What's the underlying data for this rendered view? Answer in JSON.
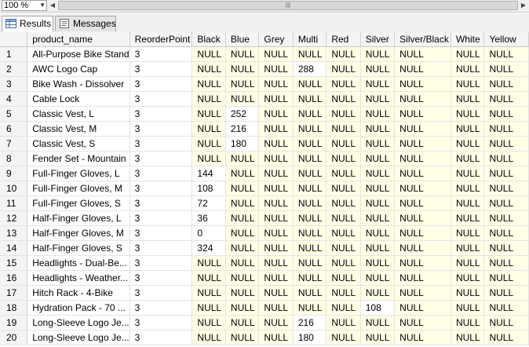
{
  "toolbar": {
    "zoom": "100 %"
  },
  "tabs": [
    {
      "label": "Results"
    },
    {
      "label": "Messages"
    }
  ],
  "grid": {
    "columns": [
      "product_name",
      "ReorderPoint",
      "Black",
      "Blue",
      "Grey",
      "Multi",
      "Red",
      "Silver",
      "Silver/Black",
      "White",
      "Yellow"
    ],
    "rows": [
      [
        "1",
        "All-Purpose Bike Stand",
        "3",
        "NULL",
        "NULL",
        "NULL",
        "NULL",
        "NULL",
        "NULL",
        "NULL",
        "NULL",
        "NULL"
      ],
      [
        "2",
        "AWC Logo Cap",
        "3",
        "NULL",
        "NULL",
        "NULL",
        "288",
        "NULL",
        "NULL",
        "NULL",
        "NULL",
        "NULL"
      ],
      [
        "3",
        "Bike Wash - Dissolver",
        "3",
        "NULL",
        "NULL",
        "NULL",
        "NULL",
        "NULL",
        "NULL",
        "NULL",
        "NULL",
        "NULL"
      ],
      [
        "4",
        "Cable Lock",
        "3",
        "NULL",
        "NULL",
        "NULL",
        "NULL",
        "NULL",
        "NULL",
        "NULL",
        "NULL",
        "NULL"
      ],
      [
        "5",
        "Classic Vest, L",
        "3",
        "NULL",
        "252",
        "NULL",
        "NULL",
        "NULL",
        "NULL",
        "NULL",
        "NULL",
        "NULL"
      ],
      [
        "6",
        "Classic Vest, M",
        "3",
        "NULL",
        "216",
        "NULL",
        "NULL",
        "NULL",
        "NULL",
        "NULL",
        "NULL",
        "NULL"
      ],
      [
        "7",
        "Classic Vest, S",
        "3",
        "NULL",
        "180",
        "NULL",
        "NULL",
        "NULL",
        "NULL",
        "NULL",
        "NULL",
        "NULL"
      ],
      [
        "8",
        "Fender Set - Mountain",
        "3",
        "NULL",
        "NULL",
        "NULL",
        "NULL",
        "NULL",
        "NULL",
        "NULL",
        "NULL",
        "NULL"
      ],
      [
        "9",
        "Full-Finger Gloves, L",
        "3",
        "144",
        "NULL",
        "NULL",
        "NULL",
        "NULL",
        "NULL",
        "NULL",
        "NULL",
        "NULL"
      ],
      [
        "10",
        "Full-Finger Gloves, M",
        "3",
        "108",
        "NULL",
        "NULL",
        "NULL",
        "NULL",
        "NULL",
        "NULL",
        "NULL",
        "NULL"
      ],
      [
        "11",
        "Full-Finger Gloves, S",
        "3",
        "72",
        "NULL",
        "NULL",
        "NULL",
        "NULL",
        "NULL",
        "NULL",
        "NULL",
        "NULL"
      ],
      [
        "12",
        "Half-Finger Gloves, L",
        "3",
        "36",
        "NULL",
        "NULL",
        "NULL",
        "NULL",
        "NULL",
        "NULL",
        "NULL",
        "NULL"
      ],
      [
        "13",
        "Half-Finger Gloves, M",
        "3",
        "0",
        "NULL",
        "NULL",
        "NULL",
        "NULL",
        "NULL",
        "NULL",
        "NULL",
        "NULL"
      ],
      [
        "14",
        "Half-Finger Gloves, S",
        "3",
        "324",
        "NULL",
        "NULL",
        "NULL",
        "NULL",
        "NULL",
        "NULL",
        "NULL",
        "NULL"
      ],
      [
        "15",
        "Headlights - Dual-Be...",
        "3",
        "NULL",
        "NULL",
        "NULL",
        "NULL",
        "NULL",
        "NULL",
        "NULL",
        "NULL",
        "NULL"
      ],
      [
        "16",
        "Headlights - Weather...",
        "3",
        "NULL",
        "NULL",
        "NULL",
        "NULL",
        "NULL",
        "NULL",
        "NULL",
        "NULL",
        "NULL"
      ],
      [
        "17",
        "Hitch Rack - 4-Bike",
        "3",
        "NULL",
        "NULL",
        "NULL",
        "NULL",
        "NULL",
        "NULL",
        "NULL",
        "NULL",
        "NULL"
      ],
      [
        "18",
        "Hydration Pack - 70 ...",
        "3",
        "NULL",
        "NULL",
        "NULL",
        "NULL",
        "NULL",
        "108",
        "NULL",
        "NULL",
        "NULL"
      ],
      [
        "19",
        "Long-Sleeve Logo Je...",
        "3",
        "NULL",
        "NULL",
        "NULL",
        "216",
        "NULL",
        "NULL",
        "NULL",
        "NULL",
        "NULL"
      ],
      [
        "20",
        "Long-Sleeve Logo Je...",
        "3",
        "NULL",
        "NULL",
        "NULL",
        "180",
        "NULL",
        "NULL",
        "NULL",
        "NULL",
        "NULL"
      ]
    ]
  },
  "colors": {
    "null_cell_bg": "#ffffe6",
    "header_bg": "#f4f4f4"
  }
}
